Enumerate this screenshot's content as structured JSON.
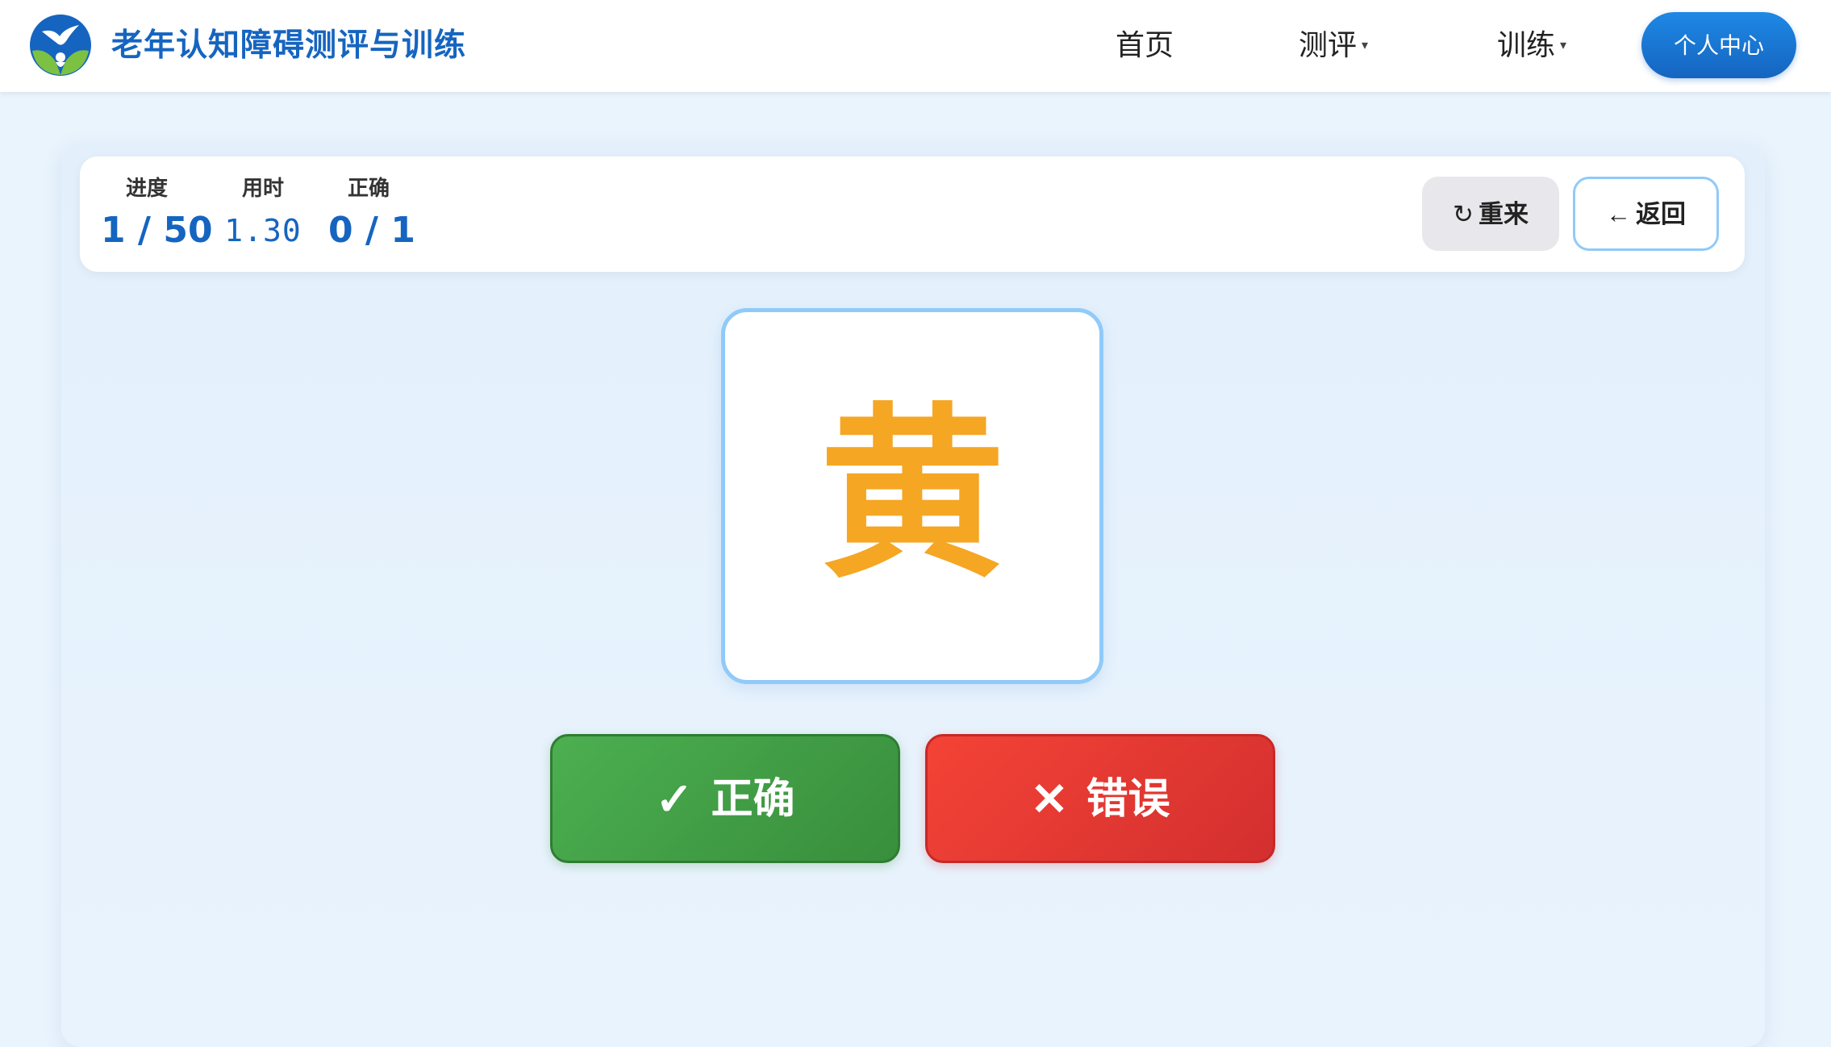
{
  "header": {
    "site_title": "老年认知障碍测评与训练",
    "nav": {
      "home": "首页",
      "assess": "测评",
      "train": "训练"
    },
    "profile_label": "个人中心",
    "logo_icon": "dove-hands-logo-icon"
  },
  "status": {
    "progress_label": "进度",
    "progress_value": "1 / 50",
    "time_label": "用时",
    "time_value": "1.30",
    "correct_label": "正确",
    "correct_value": "0 / 1",
    "restart_label": "重来",
    "back_label": "返回"
  },
  "card": {
    "character": "黄",
    "text_color": "#f5a623"
  },
  "answers": {
    "correct_label": "正确",
    "wrong_label": "错误"
  },
  "colors": {
    "brand": "#1565c0",
    "correct": "#43a047",
    "wrong": "#e53935",
    "card_border": "#90caf9"
  }
}
